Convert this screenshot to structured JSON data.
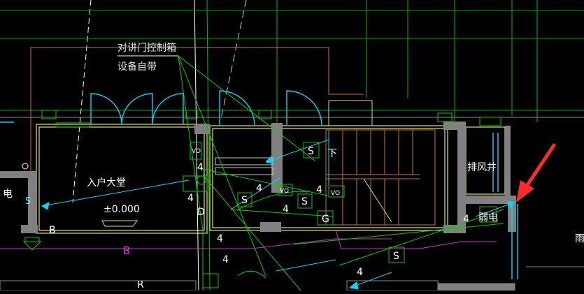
{
  "drawing": {
    "background": "#000000",
    "colors": {
      "wall": "#808080",
      "yellow": "#e8e830",
      "green": "#00d000",
      "cyan": "#00d8ff",
      "orange": "#c87832",
      "magenta": "#d030d0",
      "arrow": "#ff2a2a"
    },
    "labels": {
      "intercom_box_line1": "对讲门控制箱",
      "intercom_box_line2": "设备自带",
      "lobby": "入户大堂",
      "elevation": "±0.000",
      "down": "下",
      "exhaust_shaft": "排风井",
      "weak_current": "弱电",
      "electric": "电",
      "axis_b_left": "B",
      "axis_b_mid": "B",
      "axis_r": "R",
      "rain": "雨",
      "box_s": "S",
      "box_g": "G",
      "vo": "VO",
      "num_4": "4",
      "letter_d": "D",
      "letter_s": "S"
    },
    "annotation": {
      "type": "red-arrow",
      "points_to": "weak_current"
    }
  }
}
